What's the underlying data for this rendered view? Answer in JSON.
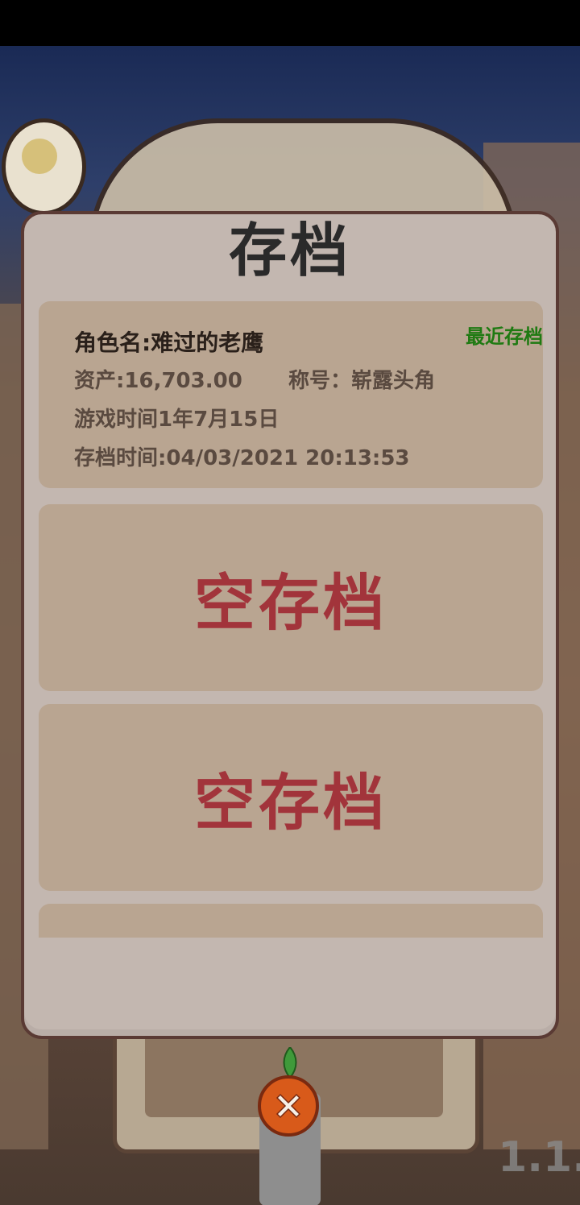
{
  "panel": {
    "title": "存档"
  },
  "slots": [
    {
      "recent_tag": "最近存档",
      "name_label": "角色名:难过的老鹰",
      "assets_label": "资产:16,703.00",
      "title_label": "称号：崭露头角",
      "game_time_label": "游戏时间1年7月15日",
      "save_time_label": "存档时间:04/03/2021  20:13:53"
    },
    {
      "empty_label": "空存档"
    },
    {
      "empty_label": "空存档"
    }
  ],
  "background": {
    "version": "1.1."
  },
  "colors": {
    "panel_bg": "#c3b7b0",
    "slot_bg": "#b9a591",
    "empty_text": "#a2343b",
    "recent_tag": "#1f7a12",
    "close_button": "#d85a1a"
  },
  "icons": {
    "close": "close-x-icon",
    "bulb": "lightbulb-icon"
  }
}
